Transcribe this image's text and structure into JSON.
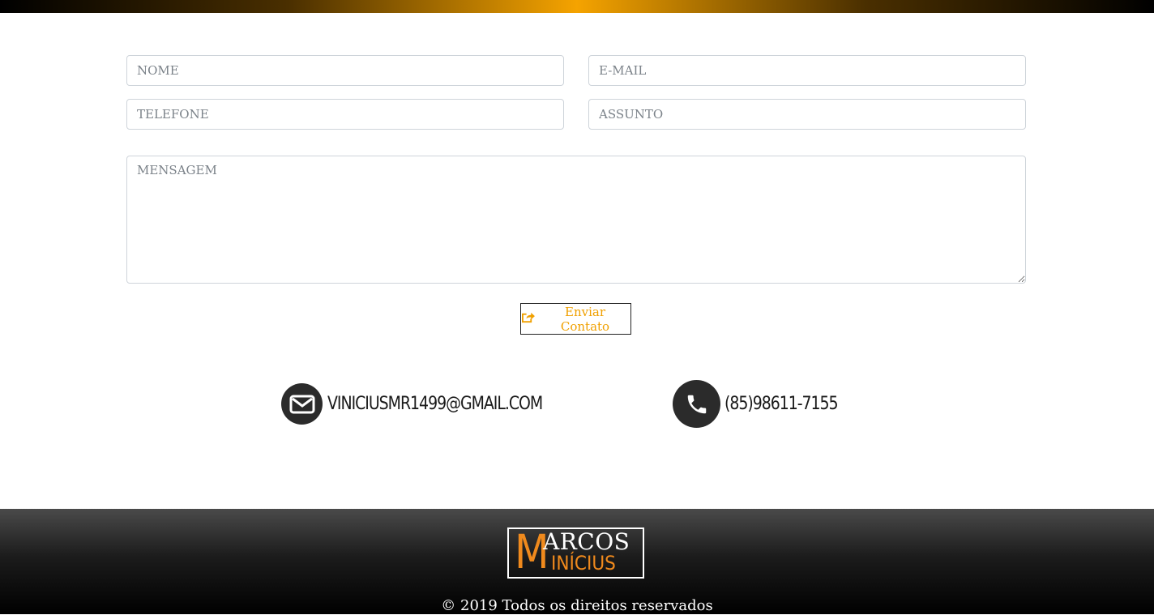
{
  "form": {
    "nome_placeholder": "NOME",
    "email_placeholder": "E-MAIL",
    "telefone_placeholder": "TELEFONE",
    "assunto_placeholder": "ASSUNTO",
    "mensagem_placeholder": "MENSAGEM",
    "submit_label": "Enviar Contato",
    "submit_icon": "share-square-icon"
  },
  "contacts": {
    "email": {
      "icon": "envelope-icon",
      "text": "VINICIUSMR1499@GMAIL.COM"
    },
    "phone": {
      "icon": "phone-icon",
      "text": "(85)98611-7155"
    }
  },
  "footer": {
    "logo": {
      "initial": "M",
      "line1": "ARCOS",
      "line2": "INÍCIUS"
    },
    "copyright": "© 2019 Todos os direitos reservados"
  },
  "colors": {
    "accent": "#f0a000",
    "logo_orange": "#f08a1d",
    "icon_circle": "#2b2b2b"
  }
}
